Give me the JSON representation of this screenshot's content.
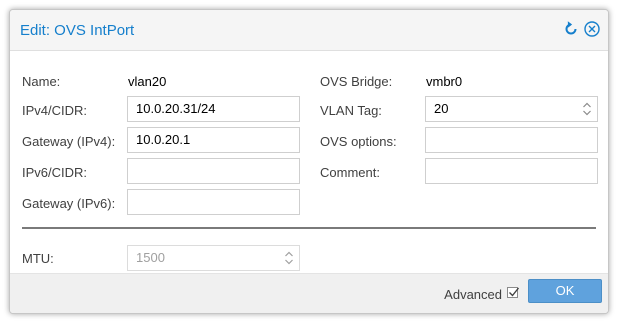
{
  "dialog": {
    "title": "Edit: OVS IntPort",
    "tools": [
      {
        "icon": "refresh-icon",
        "label": "Reset"
      },
      {
        "icon": "close-icon",
        "label": "Close"
      }
    ]
  },
  "form": {
    "left": [
      {
        "label": "Name:",
        "value": "vlan20",
        "type": "display"
      },
      {
        "label": "IPv4/CIDR:",
        "value": "10.0.20.31/24",
        "type": "text"
      },
      {
        "label": "Gateway (IPv4):",
        "value": "10.0.20.1",
        "type": "text"
      },
      {
        "label": "IPv6/CIDR:",
        "value": "",
        "type": "text"
      },
      {
        "label": "Gateway (IPv6):",
        "value": "",
        "type": "text"
      }
    ],
    "right": [
      {
        "label": "OVS Bridge:",
        "value": "vmbr0",
        "type": "display"
      },
      {
        "label": "VLAN Tag:",
        "value": "20",
        "type": "number"
      },
      {
        "label": "OVS options:",
        "value": "",
        "type": "text"
      },
      {
        "label": "Comment:",
        "value": "",
        "type": "text"
      }
    ],
    "advanced": {
      "mtu_label": "MTU:",
      "mtu_placeholder": "1500"
    }
  },
  "footer": {
    "advanced_label": "Advanced",
    "advanced_checked": true,
    "ok_label": "OK"
  },
  "colors": {
    "accent": "#157fcc",
    "ok_button": "#5fa2dd"
  }
}
